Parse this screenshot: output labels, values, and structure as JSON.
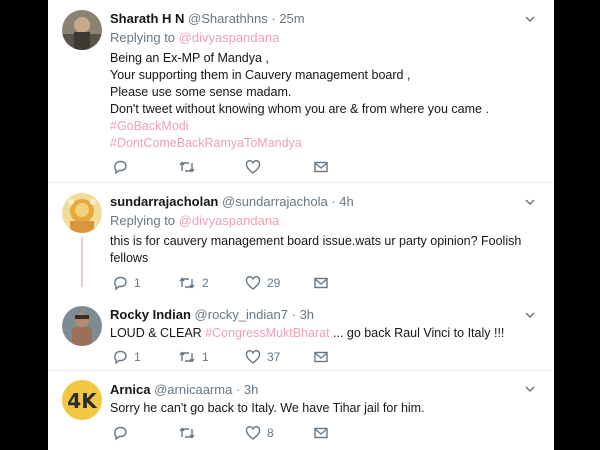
{
  "colors": {
    "accent": "#f0a0b4",
    "muted": "#657786"
  },
  "tweets": [
    {
      "name": "Sharath H N",
      "handle": "@Sharathhns",
      "dot": "·",
      "time": "25m",
      "reply_prefix": "Replying to ",
      "reply_to": "@divyaspandana",
      "lines": [
        "Being an Ex-MP of Mandya ,",
        "Your supporting them in Cauvery management board ,",
        "Please use some sense madam.",
        "Don't tweet without knowing whom you are & from where you came ."
      ],
      "hashtags": [
        "#GoBackModi",
        "#DontComeBackRamyaToMandya"
      ],
      "counts": {
        "reply": "",
        "retweet": "",
        "like": ""
      }
    },
    {
      "name": "sundarrajacholan",
      "handle": "@sundarrajachola",
      "dot": "·",
      "time": "4h",
      "reply_prefix": "Replying to ",
      "reply_to": "@divyaspandana",
      "lines": [
        "this is for cauvery management board issue.wats ur party opinion? Foolish",
        "fellows"
      ],
      "counts": {
        "reply": "1",
        "retweet": "2",
        "like": "29"
      }
    },
    {
      "name": "Rocky Indian",
      "handle": "@rocky_indian7",
      "dot": "·",
      "time": "3h",
      "text_before": "LOUD & CLEAR ",
      "hashtag": "#CongressMuktBharat",
      "text_after": " ... go back Raul Vinci to Italy !!!",
      "counts": {
        "reply": "1",
        "retweet": "1",
        "like": "37"
      }
    },
    {
      "name": "Arnica",
      "handle": "@arnicaarma",
      "dot": "·",
      "time": "3h",
      "text": "Sorry he can't go back to Italy. We have Tihar jail for him.",
      "counts": {
        "reply": "",
        "retweet": "",
        "like": "8"
      }
    }
  ],
  "icons": [
    "chevron-down-icon",
    "reply-icon",
    "retweet-icon",
    "like-icon",
    "message-icon"
  ]
}
